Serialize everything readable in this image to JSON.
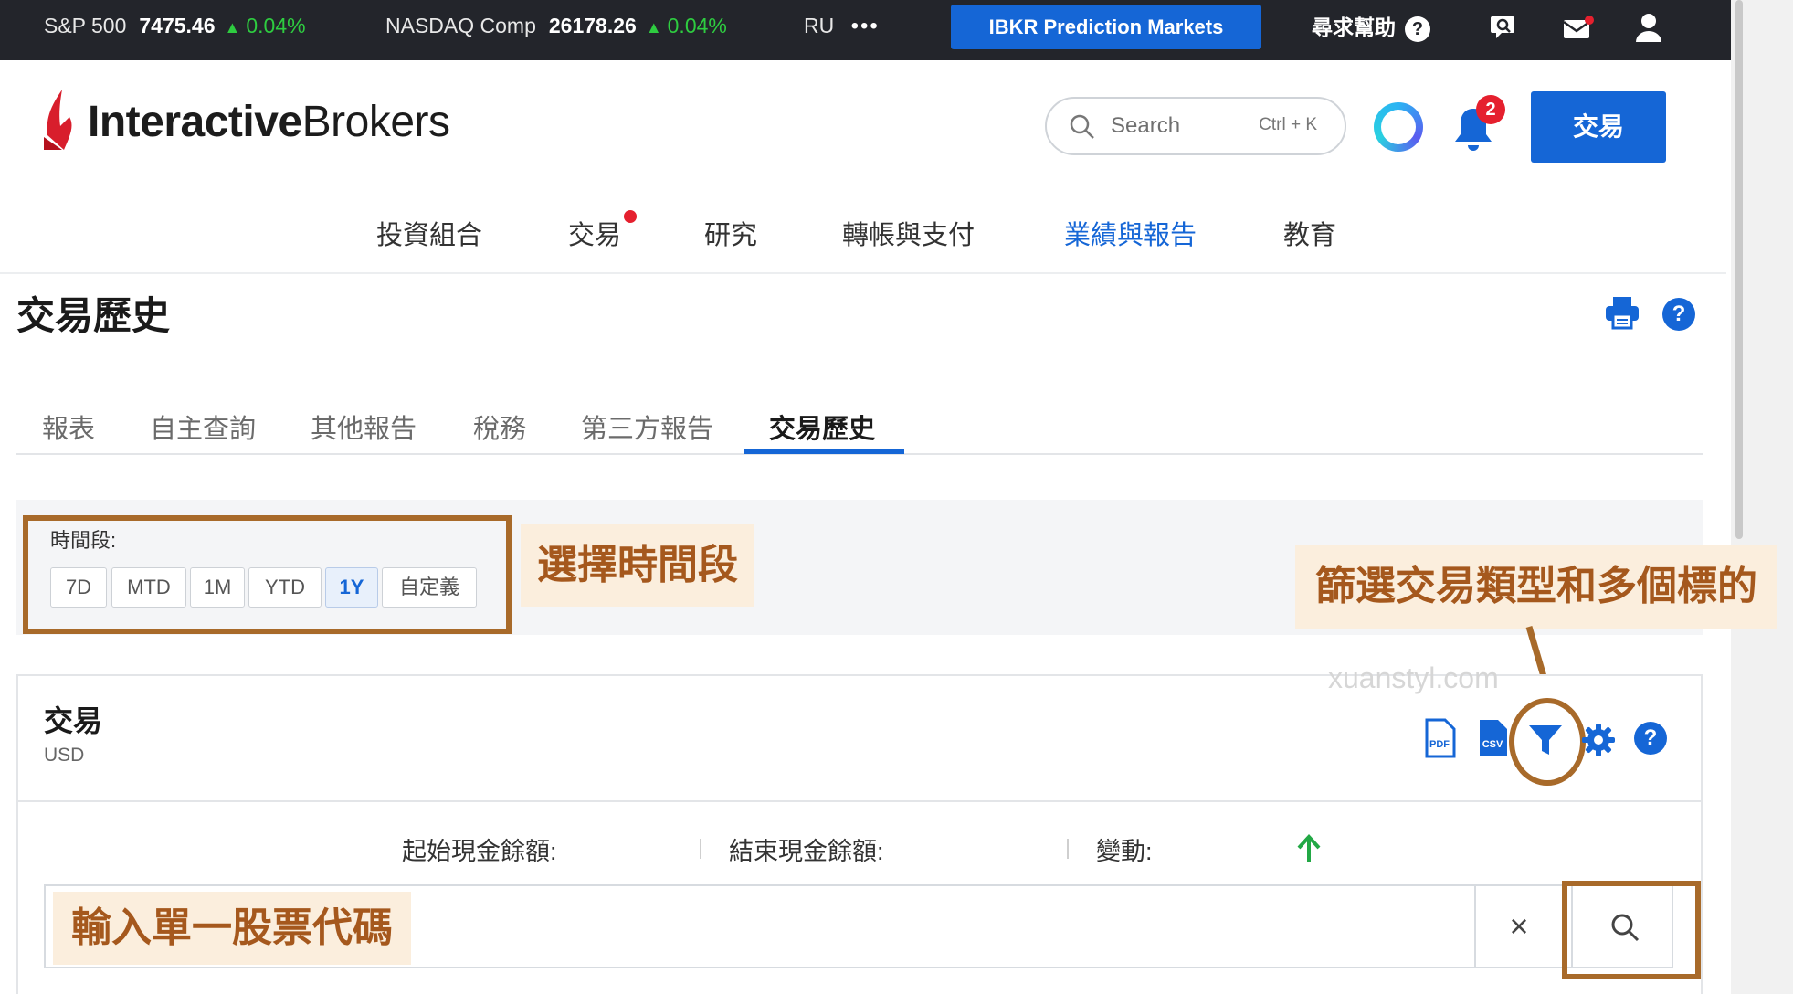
{
  "ticker": {
    "items": [
      {
        "symbol": "S&P 500",
        "value": "7475.46",
        "change": "0.04%"
      },
      {
        "symbol": "NASDAQ Comp",
        "value": "26178.26",
        "change": "0.04%"
      }
    ],
    "more_label": "RU",
    "more_dots": "•••",
    "prediction_markets": "IBKR Prediction Markets",
    "help": "尋求幫助",
    "help_glyph": "?"
  },
  "header": {
    "logo_bold": "Interactive",
    "logo_regular": "Brokers",
    "search_placeholder": "Search",
    "search_shortcut": "Ctrl + K",
    "notification_count": "2",
    "trade_button": "交易"
  },
  "main_nav": [
    "投資組合",
    "交易",
    "研究",
    "轉帳與支付",
    "業績與報告",
    "教育"
  ],
  "page": {
    "title": "交易歷史",
    "help_glyph": "?"
  },
  "tabs": [
    "報表",
    "自主查詢",
    "其他報告",
    "稅務",
    "第三方報告",
    "交易歷史"
  ],
  "period": {
    "label": "時間段:",
    "options": [
      "7D",
      "MTD",
      "1M",
      "YTD",
      "1Y",
      "自定義"
    ],
    "selected": "1Y"
  },
  "card": {
    "title": "交易",
    "currency": "USD",
    "help_glyph": "?"
  },
  "summary": {
    "start_cash": "起始現金餘額:",
    "end_cash": "結束現金餘額:",
    "change": "變動:"
  },
  "symbol_search": {
    "clear": "×"
  },
  "annotations": {
    "period": "選擇時間段",
    "filter": "篩選交易類型和多個標的",
    "symbol": "輸入單一股票代碼"
  },
  "watermark": "xuanstyl.com",
  "colors": {
    "accent_blue": "#1566d6",
    "ticker_bg": "#23252b",
    "up_green": "#2ecc40",
    "badge_red": "#e5202e",
    "annotation_brown": "#a86a2a",
    "annotation_bg": "#fbeedd"
  }
}
